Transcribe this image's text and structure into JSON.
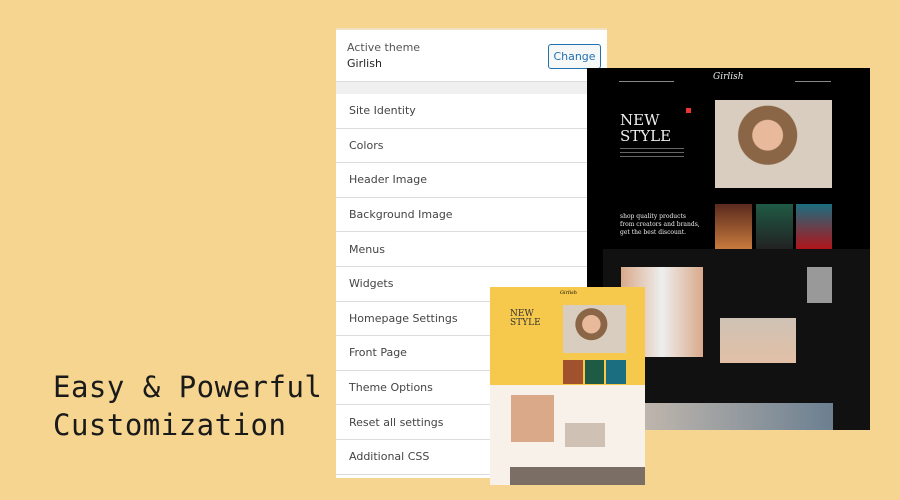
{
  "headline": {
    "line1": "Easy & Powerful",
    "line2": "Customization"
  },
  "panel": {
    "active_label": "Active theme",
    "theme_name": "Girlish",
    "change_label": "Change",
    "items": [
      "Site Identity",
      "Colors",
      "Header Image",
      "Background Image",
      "Menus",
      "Widgets",
      "Homepage Settings",
      "Front Page",
      "Theme Options",
      "Reset all settings",
      "Additional CSS"
    ]
  },
  "preview": {
    "logo": "Girlish",
    "hero_line1": "NEW",
    "hero_line2": "STYLE",
    "tagline_1": "shop quality products",
    "tagline_2": "from creators and brands,",
    "tagline_3": "get the best discount."
  }
}
